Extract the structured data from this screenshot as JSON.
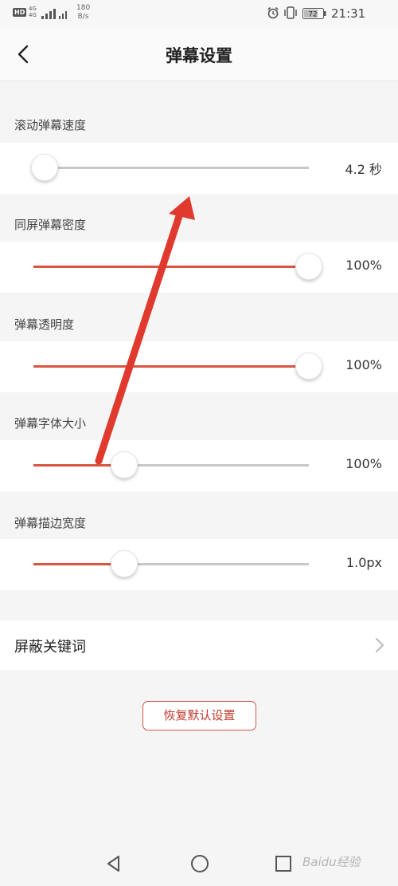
{
  "status_bar": {
    "hd": "HD",
    "network": [
      "4G",
      "4G"
    ],
    "speed": [
      "180",
      "B/s"
    ],
    "battery": "72",
    "time": "21:31"
  },
  "header": {
    "title": "弹幕设置"
  },
  "sliders": [
    {
      "label": "滚动弹幕速度",
      "value": "4.2 秒",
      "level": 0.04
    },
    {
      "label": "同屏弹幕密度",
      "value": "100%",
      "level": 1.0
    },
    {
      "label": "弹幕透明度",
      "value": "100%",
      "level": 1.0
    },
    {
      "label": "弹幕字体大小",
      "value": "100%",
      "level": 0.33
    },
    {
      "label": "弹幕描边宽度",
      "value": "1.0px",
      "level": 0.33
    }
  ],
  "keyword_row": {
    "label": "屏蔽关键词"
  },
  "reset_button": {
    "label": "恢复默认设置"
  },
  "watermark": "Baidu经验",
  "colors": {
    "accent": "#d9553f",
    "track": "#c8c8c8",
    "annotation_arrow": "#e03a2f"
  }
}
